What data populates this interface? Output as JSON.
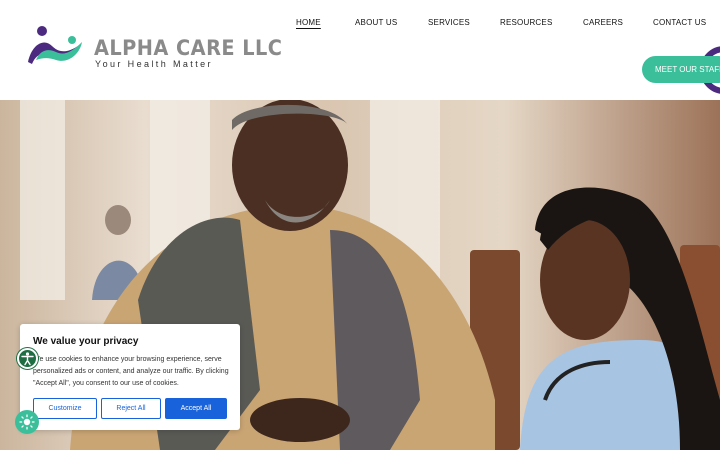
{
  "brand": {
    "name": "ALPHA CARE LLC",
    "tagline": "Your Health Matter",
    "colors": {
      "purple": "#4b2a7f",
      "teal": "#3bbf9a",
      "primary_blue": "#1863dc"
    }
  },
  "nav": {
    "items": [
      {
        "label": "HOME",
        "active": true
      },
      {
        "label": "ABOUT US"
      },
      {
        "label": "SERVICES"
      },
      {
        "label": "RESOURCES"
      },
      {
        "label": "CAREERS"
      },
      {
        "label": "CONTACT US"
      }
    ],
    "cta_label": "MEET OUR STAFF"
  },
  "hero": {
    "image": "photo of an elderly man in a cardigan with a nurse in scrubs and stethoscope"
  },
  "cookie_banner": {
    "title": "We value your privacy",
    "text": "We use cookies to enhance your browsing experience, serve personalized ads or content, and analyze our traffic. By clicking \"Accept All\", you consent to our use of cookies.",
    "buttons": {
      "customize": "Customize",
      "reject": "Reject All",
      "accept": "Accept All"
    }
  },
  "icons": {
    "accessibility": "accessibility-icon",
    "theme_toggle": "sun-icon"
  }
}
